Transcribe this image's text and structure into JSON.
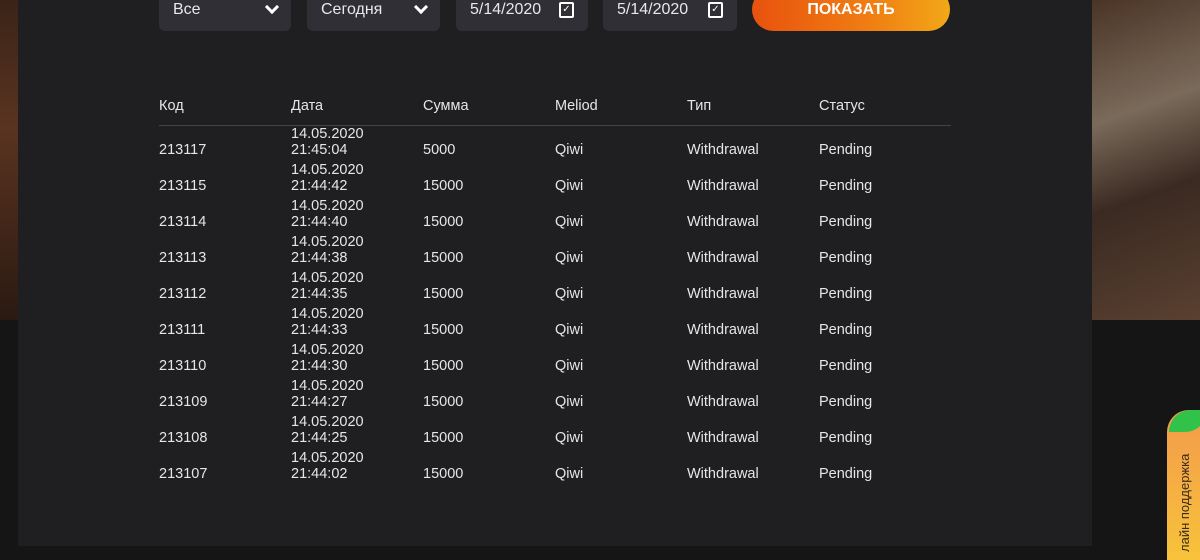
{
  "filters": {
    "type": "Все",
    "period": "Сегодня",
    "date_from": "5/14/2020",
    "date_to": "5/14/2020",
    "show_button": "ПОКАЗАТЬ"
  },
  "table": {
    "headers": [
      "Код",
      "Дата",
      "Сумма",
      "Meliod",
      "Тип",
      "Статус"
    ],
    "rows": [
      [
        "213117",
        "14.05.2020 21:45:04",
        "5000",
        "Qiwi",
        "Withdrawal",
        "Pending"
      ],
      [
        "213115",
        "14.05.2020 21:44:42",
        "15000",
        "Qiwi",
        "Withdrawal",
        "Pending"
      ],
      [
        "213114",
        "14.05.2020 21:44:40",
        "15000",
        "Qiwi",
        "Withdrawal",
        "Pending"
      ],
      [
        "213113",
        "14.05.2020 21:44:38",
        "15000",
        "Qiwi",
        "Withdrawal",
        "Pending"
      ],
      [
        "213112",
        "14.05.2020 21:44:35",
        "15000",
        "Qiwi",
        "Withdrawal",
        "Pending"
      ],
      [
        "213111",
        "14.05.2020 21:44:33",
        "15000",
        "Qiwi",
        "Withdrawal",
        "Pending"
      ],
      [
        "213110",
        "14.05.2020 21:44:30",
        "15000",
        "Qiwi",
        "Withdrawal",
        "Pending"
      ],
      [
        "213109",
        "14.05.2020 21:44:27",
        "15000",
        "Qiwi",
        "Withdrawal",
        "Pending"
      ],
      [
        "213108",
        "14.05.2020 21:44:25",
        "15000",
        "Qiwi",
        "Withdrawal",
        "Pending"
      ],
      [
        "213107",
        "14.05.2020 21:44:02",
        "15000",
        "Qiwi",
        "Withdrawal",
        "Pending"
      ]
    ]
  },
  "support": {
    "label": "лайн поддержка"
  }
}
